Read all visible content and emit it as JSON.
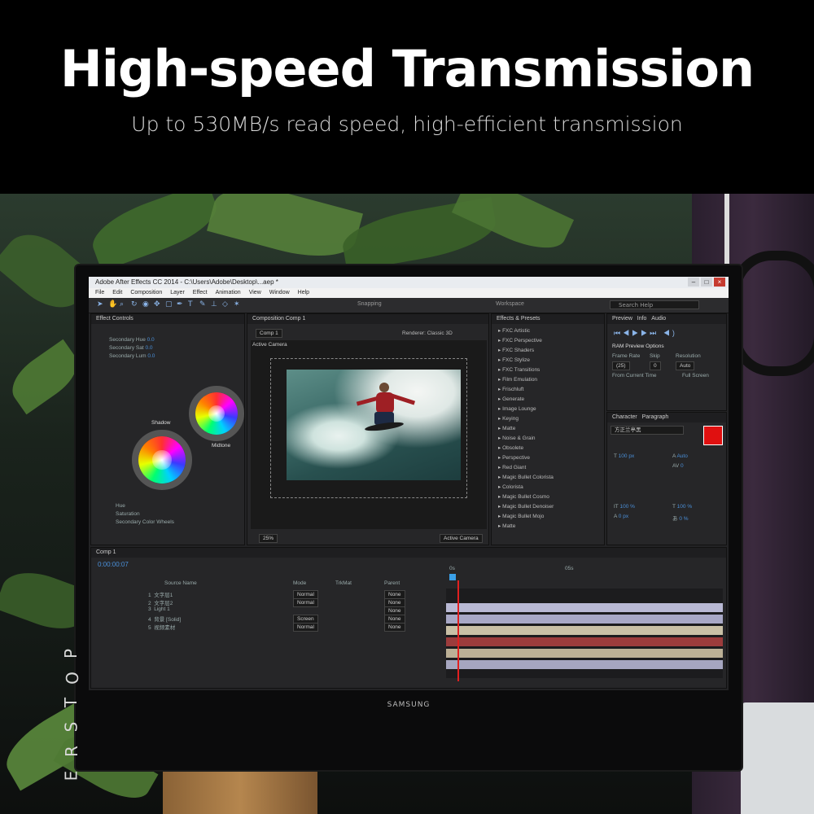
{
  "banner": {
    "headline": "High-speed Transmission",
    "subline": "Up to 530MB/s read speed, high-efficient transmission"
  },
  "watermark": {
    "letters": [
      "P",
      "O",
      "T",
      "S",
      "R",
      "E"
    ]
  },
  "monitor": {
    "brand": "SAMSUNG"
  },
  "app": {
    "title": "Adobe After Effects CC 2014 - C:\\Users\\Adobe\\Desktop\\...aep *",
    "window_buttons": [
      "–",
      "□",
      "×"
    ],
    "menu": [
      "File",
      "Edit",
      "Composition",
      "Layer",
      "Effect",
      "Animation",
      "View",
      "Window",
      "Help"
    ],
    "toolbar": {
      "snapping": "Snapping",
      "workspace": "Workspace",
      "search": "Search Help"
    },
    "effect_controls": {
      "tab": "Effect Controls",
      "rows": [
        "Secondary Hue",
        "Secondary Sat",
        "Secondary Lum",
        "Shadows",
        "Midtones",
        "Hue",
        "Saturation",
        "Secondary Color Wheels"
      ],
      "values": [
        "0.0",
        "0.0",
        "0.0"
      ],
      "wheel_labels": [
        "Shadow",
        "Midtone"
      ]
    },
    "composition": {
      "tab": "Composition Comp 1",
      "sub_tab": "Comp 1",
      "view_label": "Active Camera",
      "renderer": "Renderer: Classic 3D",
      "zoom": "25%",
      "camera": "Active Camera"
    },
    "effects_presets": {
      "tab": "Effects & Presets",
      "items": [
        "FXC Artistic",
        "FXC Perspective",
        "FXC Shaders",
        "FXC Stylize",
        "FXC Transitions",
        "Film Emulation",
        "Frischluft",
        "Generate",
        "Image Lounge",
        "Keying",
        "Matte",
        "Noise & Grain",
        "Obsolete",
        "Perspective",
        "Red Giant",
        "Magic Bullet Colorista",
        "Colorista",
        "Magic Bullet Cosmo",
        "Magic Bullet Denoiser",
        "Magic Bullet Mojo",
        "Matte"
      ]
    },
    "preview": {
      "tabs": [
        "Preview",
        "Info",
        "Audio"
      ],
      "ram_options": "RAM Preview Options",
      "frame_rate_label": "Frame Rate",
      "skip_label": "Skip",
      "resolution_label": "Resolution",
      "frame_rate": "(25)",
      "skip": "0",
      "resolution": "Auto",
      "from_current": "From Current Time",
      "full_screen": "Full Screen"
    },
    "character": {
      "tabs": [
        "Character",
        "Paragraph"
      ],
      "font": "方正兰亭黑",
      "size": "100 px",
      "leading": "Auto",
      "tracking": "0",
      "scale_v": "100 %",
      "scale_h": "100 %",
      "baseline": "0 px",
      "tsume": "0 %"
    },
    "timeline": {
      "tab": "Comp 1",
      "timecode": "0:00:00:07",
      "layers": [
        {
          "index": "1",
          "name": "文字层1",
          "mode": "Normal",
          "parent": "None"
        },
        {
          "index": "2",
          "name": "文字层2",
          "mode": "Normal",
          "parent": "None"
        },
        {
          "index": "3",
          "name": "Light 1",
          "mode": "",
          "parent": "None"
        },
        {
          "index": "4",
          "name": "背景 [Solid]",
          "mode": "Screen",
          "parent": "None"
        },
        {
          "index": "5",
          "name": "视频素材",
          "mode": "Normal",
          "parent": "None"
        }
      ],
      "columns": [
        "Source Name",
        "Mode",
        "TrkMat",
        "Parent"
      ],
      "ruler": [
        "0s",
        "05s"
      ],
      "track_colors": [
        "#b9b9d4",
        "#a8a8c6",
        "#c9c0a6",
        "#9c3c3c",
        "#bcb096",
        "#a6a6c0"
      ]
    }
  }
}
